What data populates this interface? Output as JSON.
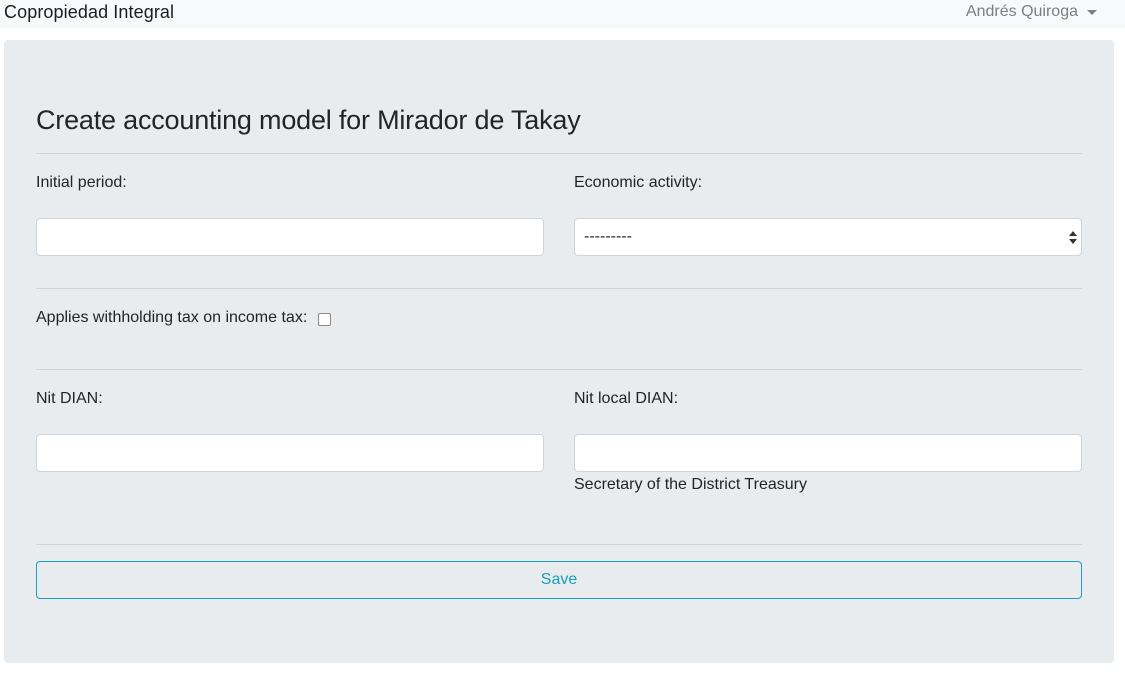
{
  "navbar": {
    "brand": "Copropiedad Integral",
    "user_name": "Andrés Quiroga"
  },
  "form": {
    "title": "Create accounting model for Mirador de Takay",
    "initial_period": {
      "label": "Initial period:",
      "value": ""
    },
    "economic_activity": {
      "label": "Economic activity:",
      "selected": "---------"
    },
    "withholding": {
      "label": "Applies withholding tax on income tax:",
      "checked": false
    },
    "nit_dian": {
      "label": "Nit DIAN:",
      "value": ""
    },
    "nit_local_dian": {
      "label": "Nit local DIAN:",
      "value": "",
      "help_text": "Secretary of the District Treasury"
    },
    "save_label": "Save"
  },
  "colors": {
    "accent": "#17a2b8",
    "panel_bg": "#e9ecef",
    "navbar_bg": "#f8f9fa"
  }
}
